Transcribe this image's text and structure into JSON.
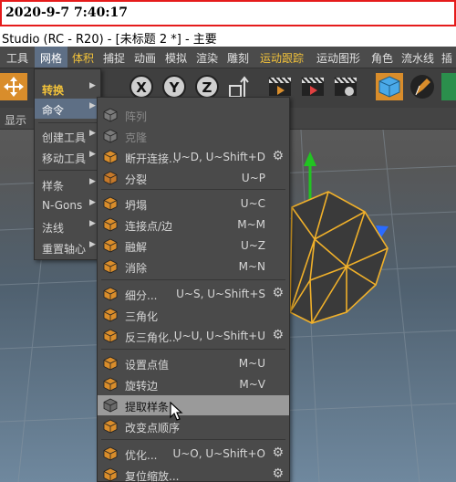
{
  "timestamp": "2020-9-7 7:40:17",
  "window_title": "Studio (RC - R20) - [未标题 2 *] - 主要",
  "menubar": [
    "工具",
    "网格",
    "体积",
    "捕捉",
    "动画",
    "模拟",
    "渲染",
    "雕刻",
    "运动跟踪",
    "运动图形",
    "角色",
    "流水线",
    "插"
  ],
  "viewport_label": "显示",
  "grid_menu": {
    "items": [
      "转换",
      "命令",
      "创建工具",
      "移动工具",
      "样条",
      "N-Gons",
      "法线",
      "重置轴心"
    ]
  },
  "command_menu": {
    "items": [
      {
        "label": "阵列",
        "shortcut": "",
        "disabled": true,
        "gear": false,
        "icon": "array-icon"
      },
      {
        "label": "克隆",
        "shortcut": "",
        "disabled": true,
        "gear": false,
        "icon": "clone-icon"
      },
      {
        "label": "断开连接...",
        "shortcut": "U~D, U~Shift+D",
        "disabled": false,
        "gear": true,
        "icon": "disconnect-icon"
      },
      {
        "label": "分裂",
        "shortcut": "U~P",
        "disabled": false,
        "gear": false,
        "icon": "split-icon"
      },
      {
        "label": "坍塌",
        "shortcut": "U~C",
        "disabled": false,
        "gear": false,
        "icon": "collapse-icon"
      },
      {
        "label": "连接点/边",
        "shortcut": "M~M",
        "disabled": false,
        "gear": false,
        "icon": "connect-icon"
      },
      {
        "label": "融解",
        "shortcut": "U~Z",
        "disabled": false,
        "gear": false,
        "icon": "melt-icon"
      },
      {
        "label": "消除",
        "shortcut": "M~N",
        "disabled": false,
        "gear": false,
        "icon": "dissolve-icon"
      },
      {
        "label": "细分...",
        "shortcut": "U~S, U~Shift+S",
        "disabled": false,
        "gear": true,
        "icon": "subdivide-icon"
      },
      {
        "label": "三角化",
        "shortcut": "",
        "disabled": false,
        "gear": false,
        "icon": "triangulate-icon"
      },
      {
        "label": "反三角化...",
        "shortcut": "U~U, U~Shift+U",
        "disabled": false,
        "gear": true,
        "icon": "untriangulate-icon"
      },
      {
        "label": "设置点值",
        "shortcut": "M~U",
        "disabled": false,
        "gear": false,
        "icon": "set-point-value-icon"
      },
      {
        "label": "旋转边",
        "shortcut": "M~V",
        "disabled": false,
        "gear": false,
        "icon": "spin-edge-icon"
      },
      {
        "label": "提取样条",
        "shortcut": "",
        "disabled": false,
        "gear": false,
        "icon": "edge-to-spline-icon"
      },
      {
        "label": "改变点顺序",
        "shortcut": "",
        "disabled": false,
        "gear": false,
        "icon": "change-point-order-icon"
      },
      {
        "label": "优化...",
        "shortcut": "U~O, U~Shift+O",
        "disabled": false,
        "gear": true,
        "icon": "optimize-icon"
      },
      {
        "label": "复位缩放...",
        "shortcut": "",
        "disabled": false,
        "gear": true,
        "icon": "reset-scale-icon"
      }
    ]
  }
}
